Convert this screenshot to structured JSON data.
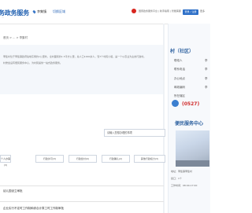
{
  "header": {
    "logo": "务政务服务",
    "logo_sub": "...",
    "location": "李集镇",
    "switch_label": "切换区域",
    "platform_text": "国家政务服务平台 | 新手指南 | 智能客服",
    "red_button": "登录 / 注册",
    "more": "更多"
  },
  "breadcrumb": "首页 > ... > 李集村",
  "intro": {
    "lines": [
      "李集村位于李集镇政府驻地东侧约1公里处，全村面积约1.5平方公里，总人口1000余人，辖7个村民小组，是一个以农业为主的行政村。",
      "村委会设有便民服务中心，为村民提供一站式政务服务。"
    ]
  },
  "guide": {
    "input_text": "请输入您想办理的事项",
    "buttons": [
      "个人办事(3)",
      "行政许可(3)",
      "行政给付(0)",
      "行政确认(2)",
      "其他行政权力(3)"
    ]
  },
  "items": [
    {
      "title": "幼儿园设立审批"
    },
    {
      "title": "企业实行不定时工作制和综合计算工时工作制审批"
    }
  ],
  "sidebar": {
    "title": "村（社区）",
    "left_items": [
      "联络人",
      "联系电话",
      "办公地点",
      "邮政编码",
      "所在辖区"
    ],
    "right_items": [
      "李",
      "李",
      "李",
      "李",
      "李"
    ],
    "phone": "(0527)",
    "conv_title": "便民服务中心",
    "info_lines": [
      "地址：李集镇李集村",
      "窗口：1个",
      "工作时间：08:00-17:00"
    ]
  }
}
